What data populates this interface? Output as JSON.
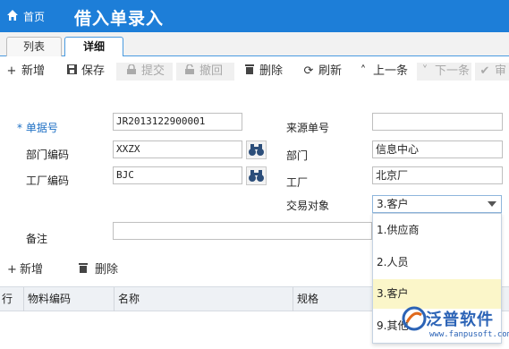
{
  "header": {
    "home_label": "首页",
    "title": "借入单录入",
    "bg_color": "#1d7ed8"
  },
  "tabs": [
    {
      "label": "列表",
      "active": false
    },
    {
      "label": "详细",
      "active": true
    }
  ],
  "toolbar": {
    "add": "新增",
    "save": "保存",
    "submit": "提交",
    "revoke": "撤回",
    "delete": "删除",
    "refresh": "刷新",
    "prev": "上一条",
    "next": "下一条",
    "approve": "审"
  },
  "form": {
    "doc_no_label": "* 单据号",
    "doc_no_value": "JR2013122900001",
    "source_no_label": "来源单号",
    "source_no_value": "",
    "dept_code_label": "部门编码",
    "dept_code_value": "XXZX",
    "dept_label": "部门",
    "dept_value": "信息中心",
    "plant_code_label": "工厂编码",
    "plant_code_value": "BJC",
    "plant_label": "工厂",
    "plant_value": "北京厂",
    "counterparty_label": "交易对象",
    "counterparty_value": "3.客户",
    "remark_label": "备注",
    "remark_value": ""
  },
  "dropdown": {
    "options": [
      "1.供应商",
      "2.人员",
      "3.客户",
      "9.其他"
    ],
    "selected_index": 2
  },
  "detail": {
    "add": "新增",
    "delete": "删除",
    "columns": [
      "行",
      "物料编码",
      "名称",
      "规格"
    ]
  },
  "watermark": {
    "brand": "泛普软件",
    "url": "www.fanpusoft.com"
  }
}
